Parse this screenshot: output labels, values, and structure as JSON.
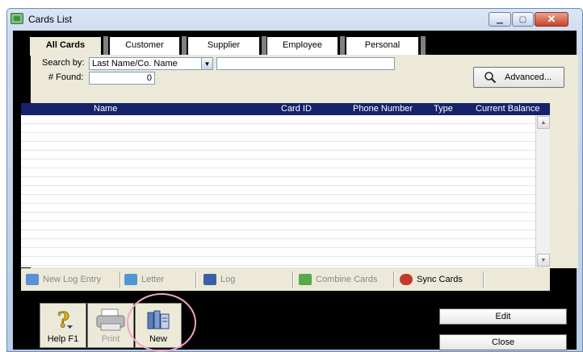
{
  "window": {
    "title": "Cards List"
  },
  "tabs": [
    {
      "label": "All Cards",
      "active": true
    },
    {
      "label": "Customer",
      "active": false
    },
    {
      "label": "Supplier",
      "active": false
    },
    {
      "label": "Employee",
      "active": false
    },
    {
      "label": "Personal",
      "active": false
    }
  ],
  "search": {
    "search_by_label": "Search by:",
    "search_by_value": "Last Name/Co. Name",
    "input_value": "",
    "found_label": "# Found:",
    "found_value": "0",
    "advanced_label": "Advanced..."
  },
  "grid": {
    "columns": [
      "Name",
      "Card ID",
      "Phone Number",
      "Type",
      "Current Balance"
    ],
    "rows": []
  },
  "actions": [
    {
      "label": "New Log Entry",
      "icon": "log-entry-icon",
      "enabled": false
    },
    {
      "label": "Letter",
      "icon": "letter-icon",
      "enabled": false
    },
    {
      "label": "Log",
      "icon": "log-icon",
      "enabled": false
    },
    {
      "label": "Combine Cards",
      "icon": "combine-cards-icon",
      "enabled": false
    },
    {
      "label": "Sync Cards",
      "icon": "sync-cards-icon",
      "enabled": true
    }
  ],
  "bottom": {
    "help_label": "Help F1",
    "print_label": "Print",
    "new_label": "New",
    "edit_label": "Edit",
    "close_label": "Close"
  },
  "colors": {
    "grid_header": "#16236b",
    "panel": "#ece9d8",
    "highlight_circle": "#f2a6c6"
  }
}
